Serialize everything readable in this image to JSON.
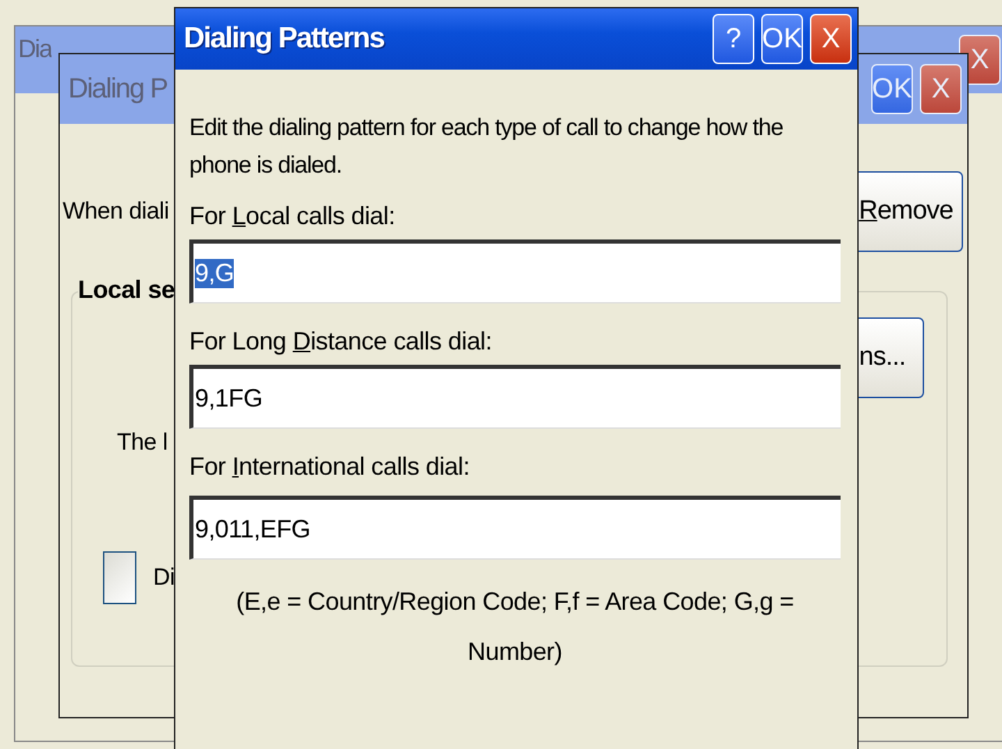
{
  "back_window": {
    "title": "Dia",
    "active": false,
    "buttons": [
      {
        "kind": "close",
        "label": "X"
      }
    ]
  },
  "middle_window": {
    "title": "Dialing P",
    "active": false,
    "buttons": [
      {
        "kind": "ok",
        "label": "OK"
      },
      {
        "kind": "close",
        "label": "X"
      }
    ],
    "intro": "When diali",
    "remove_button": {
      "access_key": "R",
      "label_after": "emove"
    },
    "group": {
      "title": "Local se",
      "options_button": "ns...",
      "text": "The l",
      "checkbox": {
        "label": "Di",
        "checked": false
      }
    }
  },
  "dialog": {
    "title": "Dialing Patterns",
    "active": true,
    "buttons": [
      {
        "kind": "help",
        "label": "?"
      },
      {
        "kind": "ok",
        "label": "OK"
      },
      {
        "kind": "close",
        "label": "X"
      }
    ],
    "description": "Edit the dialing pattern for each type of call to change how the phone is dialed.",
    "fields": [
      {
        "label_before": "For ",
        "access_key": "L",
        "label_after": "ocal calls dial:",
        "value": "9,G",
        "selected_text": true
      },
      {
        "label_before": "For Long ",
        "access_key": "D",
        "label_after": "istance calls dial:",
        "value": "9,1FG",
        "selected_text": false
      },
      {
        "label_before": "For ",
        "access_key": "I",
        "label_after": "nternational calls dial:",
        "value": "9,011,EFG",
        "selected_text": false
      }
    ],
    "legend": "(E,e = Country/Region Code; F,f = Area Code; G,g = Number)"
  }
}
